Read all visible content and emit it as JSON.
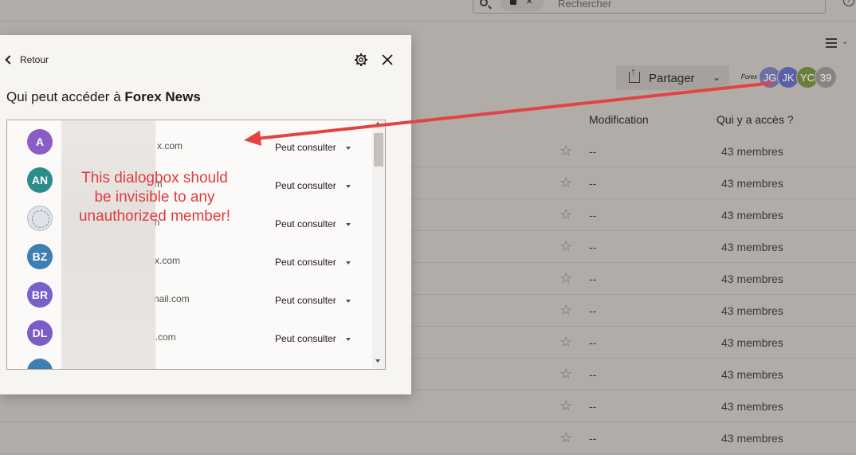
{
  "topbar": {
    "search_placeholder": "Rechercher"
  },
  "share": {
    "label": "Partager"
  },
  "avatars": [
    {
      "initials": "JG",
      "color": "#6d6ea3"
    },
    {
      "initials": "JK",
      "color": "#5a5fa8"
    },
    {
      "initials": "YC",
      "color": "#6b7d3a"
    },
    {
      "initials": "39",
      "color": "#8a8480"
    }
  ],
  "avatar_logo_text": "Forex",
  "columns": {
    "modification": "Modification",
    "access": "Qui y a accès ?"
  },
  "rows": [
    {
      "modified": "--",
      "access": "43 membres"
    },
    {
      "modified": "--",
      "access": "43 membres"
    },
    {
      "modified": "--",
      "access": "43 membres"
    },
    {
      "modified": "--",
      "access": "43 membres"
    },
    {
      "modified": "--",
      "access": "43 membres"
    },
    {
      "modified": "--",
      "access": "43 membres"
    },
    {
      "modified": "--",
      "access": "43 membres"
    },
    {
      "modified": "--",
      "access": "43 membres"
    },
    {
      "modified": "--",
      "access": "43 membres"
    },
    {
      "modified": "--",
      "access": "43 membres"
    }
  ],
  "dialog": {
    "back_label": "Retour",
    "title_prefix": "Qui peut accéder à ",
    "title_bold": "Forex News",
    "members": [
      {
        "initials": "A",
        "color": "#8a5cc7",
        "email": "x.com",
        "role": "Peut consulter"
      },
      {
        "initials": "AN",
        "color": "#2c8b8b",
        "email": "com",
        "role": "Peut consulter"
      },
      {
        "initials": "",
        "color": "#dfe3e8",
        "email": "il.com",
        "role": "Peut consulter"
      },
      {
        "initials": "BZ",
        "color": "#3e7fb1",
        "email": "x.com",
        "role": "Peut consulter"
      },
      {
        "initials": "BR",
        "color": "#7561c7",
        "email": "gmail.com",
        "role": "Peut consulter"
      },
      {
        "initials": "DL",
        "color": "#7d5cc7",
        "email": "l.com",
        "role": "Peut consulter"
      },
      {
        "initials": "",
        "color": "#3e7fb1",
        "email": "",
        "role": ""
      }
    ]
  },
  "annotation": {
    "text": "This dialogbox should\nbe invisible to any\nunauthorized member!",
    "color": "#e03b3b"
  }
}
